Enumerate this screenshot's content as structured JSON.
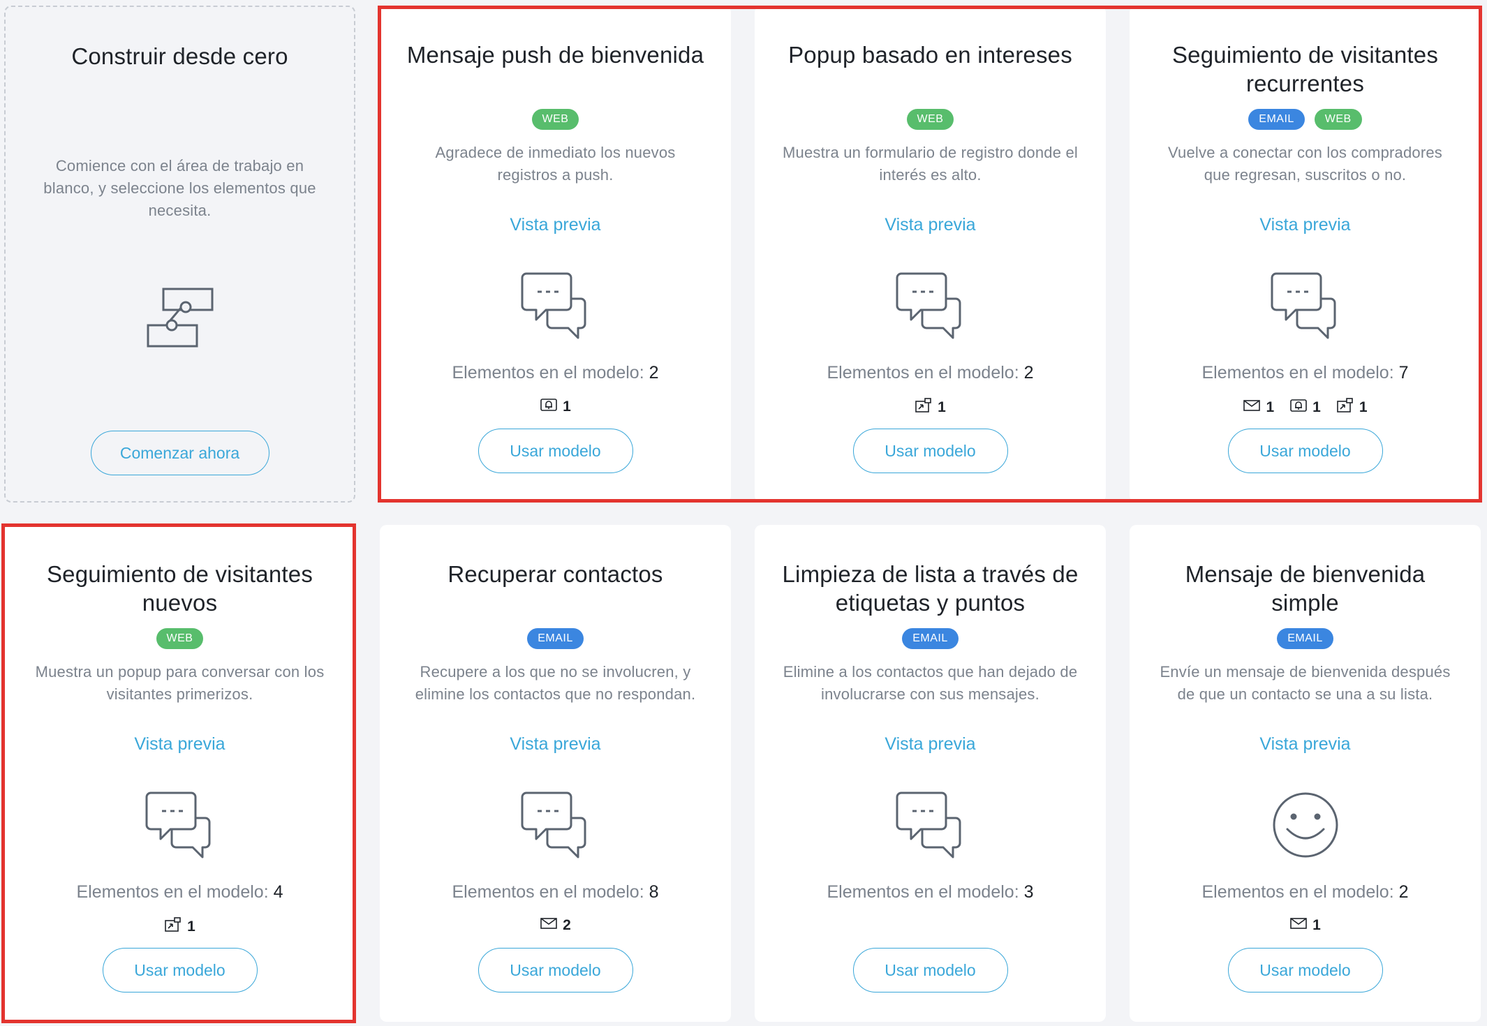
{
  "blank": {
    "title": "Construir desde cero",
    "desc": "Comience con el área de trabajo en blanco, y seleccione los elementos que necesita.",
    "button": "Comenzar ahora",
    "icon": "workflow-icon"
  },
  "cards": [
    {
      "title": "Mensaje push de bienvenida",
      "tags": [
        "WEB"
      ],
      "desc": "Agradece de inmediato los nuevos registros a push.",
      "preview": "Vista previa",
      "icon": "chat-bubbles-icon",
      "count_label": "Elementos en el modelo:",
      "count": "2",
      "mini": [
        {
          "icon": "push-icon",
          "value": "1"
        }
      ],
      "button": "Usar modelo"
    },
    {
      "title": "Popup basado en intereses",
      "tags": [
        "WEB"
      ],
      "desc": "Muestra un formulario de registro donde el interés es alto.",
      "preview": "Vista previa",
      "icon": "chat-bubbles-icon",
      "count_label": "Elementos en el modelo:",
      "count": "2",
      "mini": [
        {
          "icon": "popup-icon",
          "value": "1"
        }
      ],
      "button": "Usar modelo"
    },
    {
      "title": "Seguimiento de visitantes recurrentes",
      "tags": [
        "EMAIL",
        "WEB"
      ],
      "desc": "Vuelve a conectar con los compradores que regresan, suscritos o no.",
      "preview": "Vista previa",
      "icon": "chat-bubbles-icon",
      "count_label": "Elementos en el modelo:",
      "count": "7",
      "mini": [
        {
          "icon": "email-icon",
          "value": "1"
        },
        {
          "icon": "push-icon",
          "value": "1"
        },
        {
          "icon": "popup-icon",
          "value": "1"
        }
      ],
      "button": "Usar modelo"
    },
    {
      "title": "Seguimiento de visitantes nuevos",
      "tags": [
        "WEB"
      ],
      "desc": "Muestra un popup para conversar con los visitantes primerizos.",
      "preview": "Vista previa",
      "icon": "chat-bubbles-icon",
      "count_label": "Elementos en el modelo:",
      "count": "4",
      "mini": [
        {
          "icon": "popup-icon",
          "value": "1"
        }
      ],
      "button": "Usar modelo"
    },
    {
      "title": "Recuperar contactos",
      "tags": [
        "EMAIL"
      ],
      "desc": "Recupere a los que no se involucren, y elimine los contactos que no respondan.",
      "preview": "Vista previa",
      "icon": "chat-bubbles-icon",
      "count_label": "Elementos en el modelo:",
      "count": "8",
      "mini": [
        {
          "icon": "email-icon",
          "value": "2"
        }
      ],
      "button": "Usar modelo"
    },
    {
      "title": "Limpieza de lista a través de etiquetas y puntos",
      "tags": [
        "EMAIL"
      ],
      "desc": "Elimine a los contactos que han dejado de involucrarse con sus mensajes.",
      "preview": "Vista previa",
      "icon": "chat-bubbles-icon",
      "count_label": "Elementos en el modelo:",
      "count": "3",
      "mini": [],
      "button": "Usar modelo"
    },
    {
      "title": "Mensaje de bienvenida simple",
      "tags": [
        "EMAIL"
      ],
      "desc": "Envíe un mensaje de bienvenida después de que un contacto se una a su lista.",
      "preview": "Vista previa",
      "icon": "smiley-icon",
      "count_label": "Elementos en el modelo:",
      "count": "2",
      "mini": [
        {
          "icon": "email-icon",
          "value": "1"
        }
      ],
      "button": "Usar modelo"
    }
  ],
  "colors": {
    "accent": "#3aa7d9",
    "web_tag": "#58bd6c",
    "email_tag": "#3b86e0",
    "highlight": "#e3342f"
  }
}
